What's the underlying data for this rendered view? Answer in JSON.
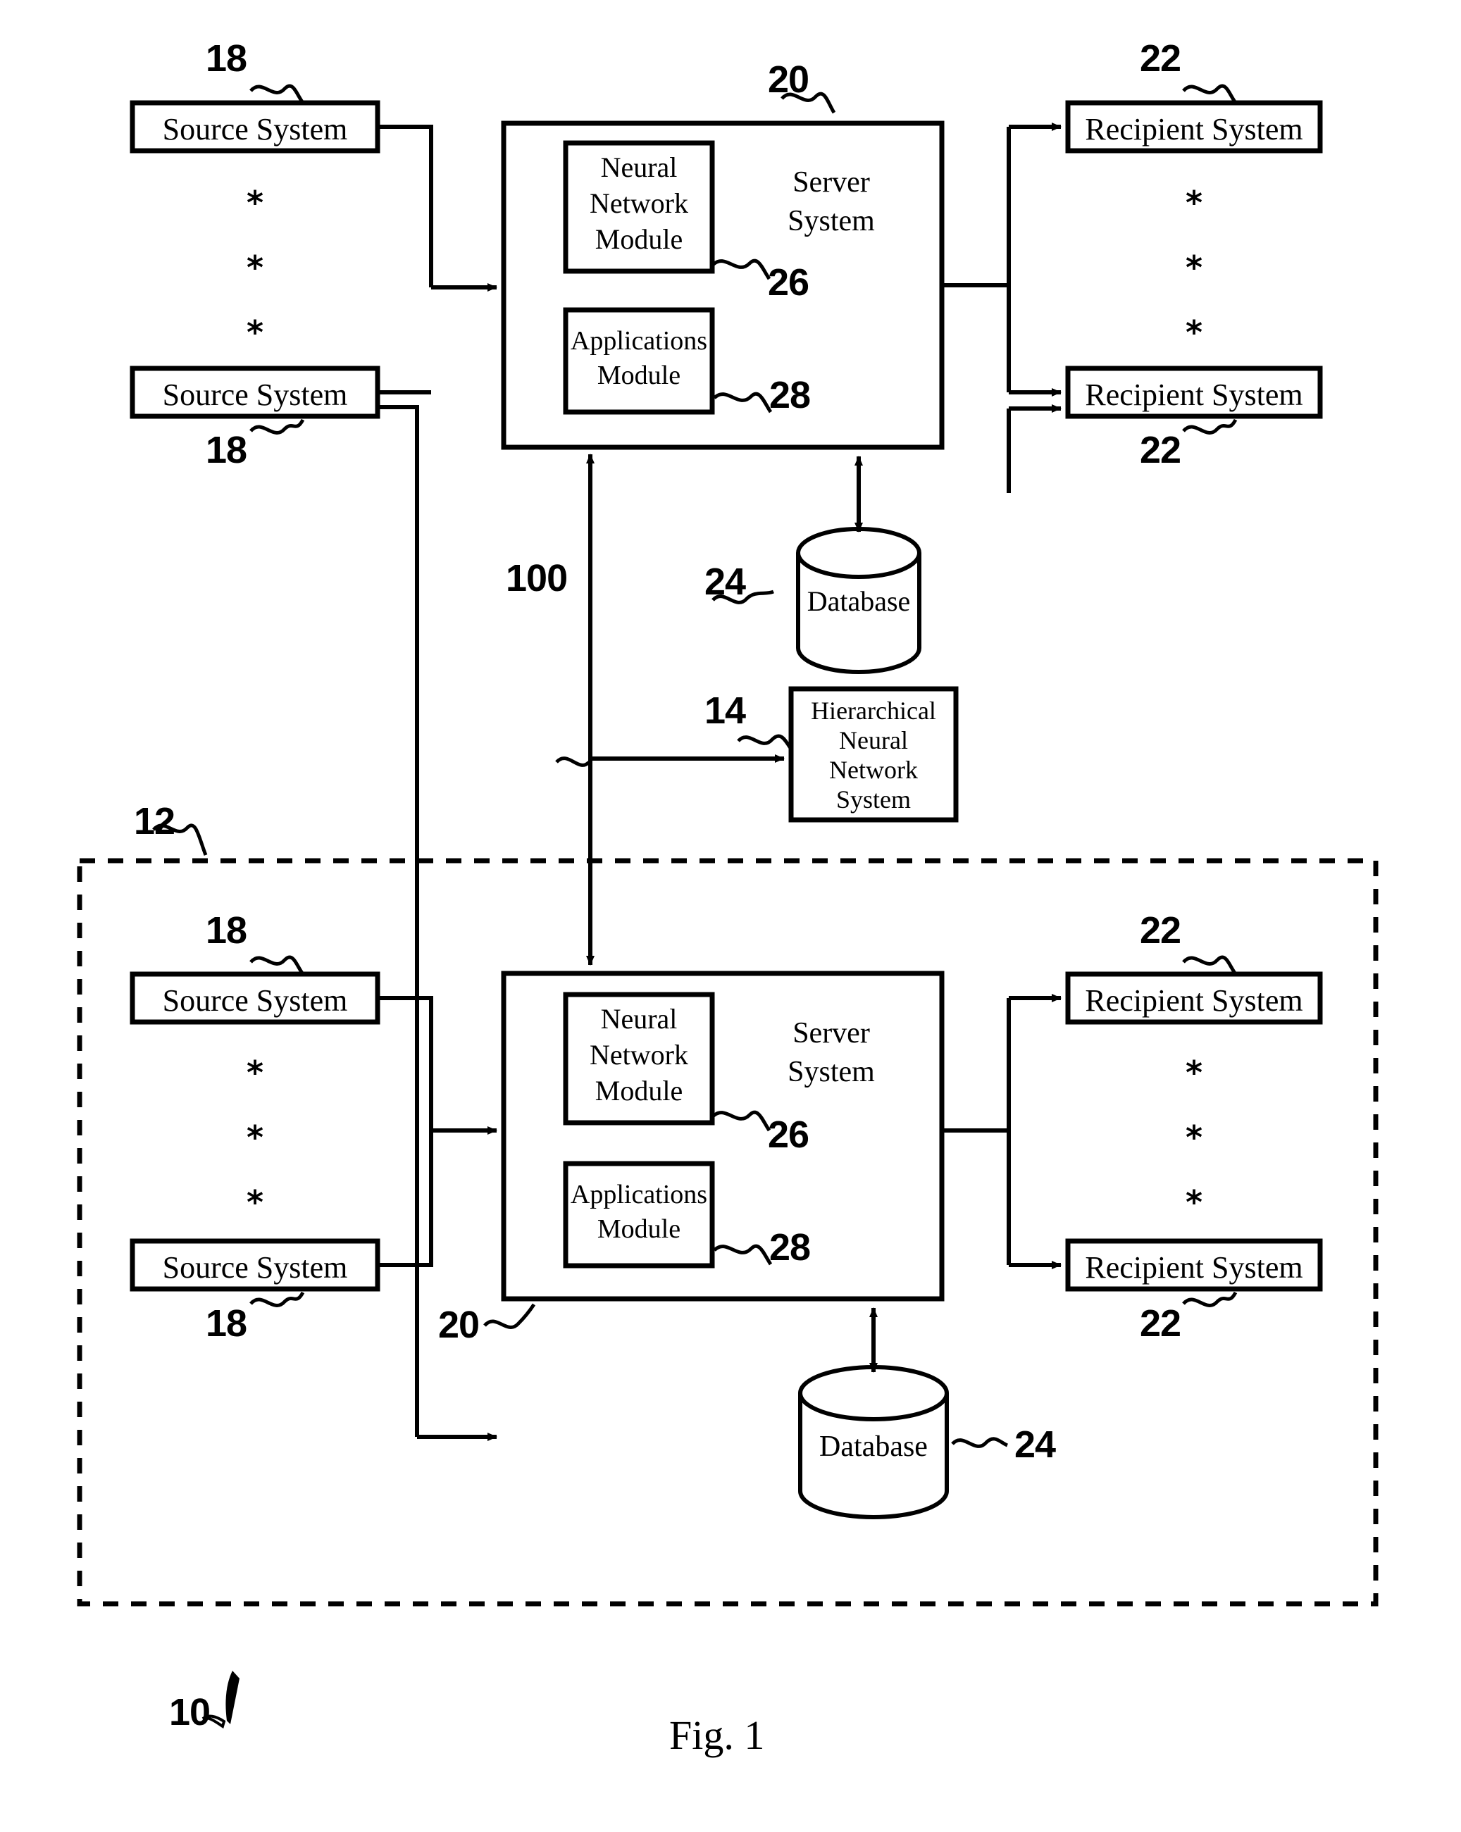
{
  "figure": {
    "caption": "Fig. 1",
    "system_ref": "10"
  },
  "reference_numerals": {
    "system": "10",
    "dashed_group": "12",
    "hierarchical_nn": "14",
    "source_system": "18",
    "server_system": "20",
    "recipient_system": "22",
    "database": "24",
    "neural_network_module": "26",
    "applications_module": "28",
    "interconnect": "100"
  },
  "blocks": {
    "source_system": "Source System",
    "recipient_system": "Recipient System",
    "server_system": "Server\nSystem",
    "server_system_line1": "Server",
    "server_system_line2": "System",
    "neural_network_module_l1": "Neural",
    "neural_network_module_l2": "Network",
    "neural_network_module_l3": "Module",
    "applications_module_l1": "Applications",
    "applications_module_l2": "Module",
    "database": "Database",
    "hierarchical_l1": "Hierarchical",
    "hierarchical_l2": "Neural",
    "hierarchical_l3": "Network",
    "hierarchical_l4": "System"
  },
  "ellipsis_marker": "*",
  "top_tier": {
    "sources": [
      {
        "label": "Source System",
        "ref": "18",
        "ref_position": "above"
      },
      {
        "label": "Source System",
        "ref": "18",
        "ref_position": "below"
      }
    ],
    "server": {
      "label_line1": "Server",
      "label_line2": "System",
      "ref": "20",
      "modules": [
        {
          "label_line1": "Neural",
          "label_line2": "Network",
          "label_line3": "Module",
          "ref": "26"
        },
        {
          "label_line1": "Applications",
          "label_line2": "Module",
          "ref": "28"
        }
      ]
    },
    "recipients": [
      {
        "label": "Recipient System",
        "ref": "22",
        "ref_position": "above"
      },
      {
        "label": "Recipient System",
        "ref": "22",
        "ref_position": "below"
      }
    ],
    "database": {
      "label": "Database",
      "ref": "24"
    }
  },
  "middle": {
    "hierarchical_neural_network_system": {
      "label_line1": "Hierarchical",
      "label_line2": "Neural",
      "label_line3": "Network",
      "label_line4": "System",
      "ref": "14"
    },
    "bus_ref": "100"
  },
  "bottom_tier": {
    "group_ref": "12",
    "sources": [
      {
        "label": "Source System",
        "ref": "18",
        "ref_position": "above"
      },
      {
        "label": "Source System",
        "ref": "18",
        "ref_position": "below"
      }
    ],
    "server": {
      "label_line1": "Server",
      "label_line2": "System",
      "ref": "20",
      "modules": [
        {
          "label_line1": "Neural",
          "label_line2": "Network",
          "label_line3": "Module",
          "ref": "26"
        },
        {
          "label_line1": "Applications",
          "label_line2": "Module",
          "ref": "28"
        }
      ]
    },
    "recipients": [
      {
        "label": "Recipient System",
        "ref": "22",
        "ref_position": "above"
      },
      {
        "label": "Recipient System",
        "ref": "22",
        "ref_position": "below"
      }
    ],
    "database": {
      "label": "Database",
      "ref": "24"
    }
  },
  "colors": {
    "stroke": "#000000",
    "background": "#ffffff"
  },
  "chart_data": {
    "type": "diagram",
    "title": "Fig. 1",
    "nodes": [
      {
        "id": "18a",
        "label": "Source System",
        "tier": "top"
      },
      {
        "id": "18b",
        "label": "Source System",
        "tier": "top"
      },
      {
        "id": "20a",
        "label": "Server System",
        "tier": "top",
        "children": [
          "26a",
          "28a"
        ]
      },
      {
        "id": "26a",
        "label": "Neural Network Module",
        "tier": "top"
      },
      {
        "id": "28a",
        "label": "Applications Module",
        "tier": "top"
      },
      {
        "id": "22a",
        "label": "Recipient System",
        "tier": "top"
      },
      {
        "id": "22b",
        "label": "Recipient System",
        "tier": "top"
      },
      {
        "id": "24a",
        "label": "Database",
        "tier": "top"
      },
      {
        "id": "14",
        "label": "Hierarchical Neural Network System",
        "tier": "middle"
      },
      {
        "id": "18c",
        "label": "Source System",
        "tier": "bottom"
      },
      {
        "id": "18d",
        "label": "Source System",
        "tier": "bottom"
      },
      {
        "id": "20b",
        "label": "Server System",
        "tier": "bottom",
        "children": [
          "26b",
          "28b"
        ]
      },
      {
        "id": "26b",
        "label": "Neural Network Module",
        "tier": "bottom"
      },
      {
        "id": "28b",
        "label": "Applications Module",
        "tier": "bottom"
      },
      {
        "id": "22c",
        "label": "Recipient System",
        "tier": "bottom"
      },
      {
        "id": "22d",
        "label": "Recipient System",
        "tier": "bottom"
      },
      {
        "id": "24b",
        "label": "Database",
        "tier": "bottom"
      }
    ],
    "edges": [
      {
        "from": "18a",
        "to": "20a",
        "type": "arrow"
      },
      {
        "from": "18b",
        "to": "20a",
        "type": "arrow"
      },
      {
        "from": "20a",
        "to": "22a",
        "type": "arrow"
      },
      {
        "from": "20a",
        "to": "22b",
        "type": "arrow"
      },
      {
        "from": "20a",
        "to": "24a",
        "type": "bidirectional"
      },
      {
        "from": "20b",
        "to": "20a",
        "type": "bidirectional",
        "label": "100"
      },
      {
        "from": "100",
        "to": "14",
        "type": "arrow"
      },
      {
        "from": "18c",
        "to": "20b",
        "type": "arrow"
      },
      {
        "from": "18d",
        "to": "20b",
        "type": "arrow"
      },
      {
        "from": "20b",
        "to": "22c",
        "type": "arrow"
      },
      {
        "from": "20b",
        "to": "22d",
        "type": "arrow"
      },
      {
        "from": "20b",
        "to": "24b",
        "type": "bidirectional"
      },
      {
        "from": "18b",
        "to": "22b",
        "type": "arrow"
      }
    ]
  }
}
